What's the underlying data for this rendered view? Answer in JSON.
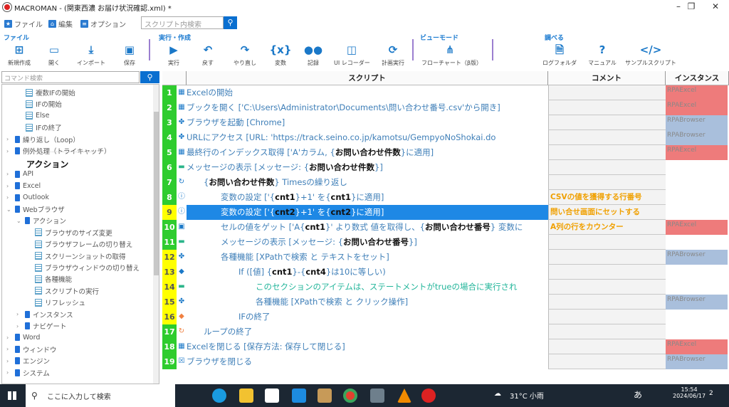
{
  "window": {
    "title": "MACROMAN - (関東西濃 お届け状況確認.xml) *",
    "minimize": "–",
    "maximize": "❐",
    "close": "✕"
  },
  "menu": [
    {
      "label": "ファイル",
      "icon": "star-icon"
    },
    {
      "label": "編集",
      "icon": "home-icon"
    },
    {
      "label": "オプション",
      "icon": "list-icon"
    }
  ],
  "script_search": {
    "placeholder": "スクリプト内検索"
  },
  "toolbar": {
    "groups": {
      "file": "ファイル",
      "run": "実行・作成",
      "view": "ビューモード",
      "lookup": "調べる"
    },
    "buttons": [
      {
        "label": "新規作成",
        "icon": "new-file-icon",
        "glyph": "⊞"
      },
      {
        "label": "開く",
        "icon": "folder-icon",
        "glyph": "▭"
      },
      {
        "label": "インポート",
        "icon": "import-icon",
        "glyph": "⤓"
      },
      {
        "label": "保存",
        "icon": "save-icon",
        "glyph": "▣"
      },
      {
        "label": "実行",
        "icon": "play-icon",
        "glyph": "▶"
      },
      {
        "label": "戻す",
        "icon": "undo-icon",
        "glyph": "↶"
      },
      {
        "label": "やり直し",
        "icon": "redo-icon",
        "glyph": "↷"
      },
      {
        "label": "変数",
        "icon": "variable-icon",
        "glyph": "{x}"
      },
      {
        "label": "記録",
        "icon": "record-icon",
        "glyph": "●●"
      },
      {
        "label": "UI レコーダー",
        "icon": "ui-recorder-icon",
        "glyph": "◫"
      },
      {
        "label": "計画実行",
        "icon": "schedule-icon",
        "glyph": "⟳"
      },
      {
        "label": "フローチャート（β版）",
        "icon": "flowchart-icon",
        "glyph": "⋔"
      },
      {
        "label": "ログフォルダ",
        "icon": "log-folder-icon",
        "glyph": "🗎"
      },
      {
        "label": "マニュアル",
        "icon": "help-icon",
        "glyph": "?"
      },
      {
        "label": "サンプルスクリプト",
        "icon": "sample-script-icon",
        "glyph": "</>"
      }
    ]
  },
  "command_search": {
    "placeholder": "コマンド検索"
  },
  "tree": [
    {
      "label": "複数IFの開始",
      "type": "doc",
      "level": 2
    },
    {
      "label": "IFの開始",
      "type": "doc",
      "level": 2
    },
    {
      "label": "Else",
      "type": "doc",
      "level": 2
    },
    {
      "label": "IFの終了",
      "type": "doc",
      "level": 2
    },
    {
      "label": "繰り返し（Loop）",
      "type": "book",
      "level": 1,
      "chev": "›"
    },
    {
      "label": "例外処理（トライキャッチ）",
      "type": "book",
      "level": 1,
      "chev": "›"
    },
    {
      "label": "アクション",
      "type": "heading",
      "level": 1
    },
    {
      "label": "API",
      "type": "book",
      "level": 1,
      "chev": "›"
    },
    {
      "label": "Excel",
      "type": "book",
      "level": 1,
      "chev": "›"
    },
    {
      "label": "Outlook",
      "type": "book",
      "level": 1,
      "chev": "›"
    },
    {
      "label": "Webブラウザ",
      "type": "book",
      "level": 1,
      "chev": "⌄"
    },
    {
      "label": "アクション",
      "type": "book",
      "level": 2,
      "chev": "⌄"
    },
    {
      "label": "ブラウザのサイズ変更",
      "type": "doc",
      "level": 3
    },
    {
      "label": "ブラウザフレームの切り替え",
      "type": "doc",
      "level": 3
    },
    {
      "label": "スクリーンショットの取得",
      "type": "doc",
      "level": 3
    },
    {
      "label": "ブラウザウィンドウの切り替え",
      "type": "doc",
      "level": 3
    },
    {
      "label": "各種機能",
      "type": "doc",
      "level": 3
    },
    {
      "label": "スクリプトの実行",
      "type": "doc",
      "level": 3
    },
    {
      "label": "リフレッシュ",
      "type": "doc",
      "level": 3
    },
    {
      "label": "インスタンス",
      "type": "book",
      "level": 2,
      "chev": "›"
    },
    {
      "label": "ナビゲート",
      "type": "book",
      "level": 2,
      "chev": "›"
    },
    {
      "label": "Word",
      "type": "book",
      "level": 1,
      "chev": "›"
    },
    {
      "label": "ウィンドウ",
      "type": "book",
      "level": 1,
      "chev": "›"
    },
    {
      "label": "エンジン",
      "type": "book",
      "level": 1,
      "chev": "›"
    },
    {
      "label": "システム",
      "type": "book",
      "level": 1,
      "chev": "›"
    }
  ],
  "grid": {
    "headers": {
      "script": "スクリプト",
      "comment": "コメント",
      "instance": "インスタンス"
    },
    "colors": {
      "green": "#2ecc2e",
      "yellow": "#ffff00",
      "excel": "#ee7b7b",
      "browser": "#a9bfdc",
      "selected": "#1e88e5"
    },
    "rows": [
      {
        "num": "1",
        "mark": "green",
        "icon": "excel-icon",
        "indent": 0,
        "segs": [
          [
            "Excelの開始",
            0
          ]
        ],
        "comment": "",
        "instance": "RPAExcel"
      },
      {
        "num": "2",
        "mark": "green",
        "icon": "excel-icon",
        "indent": 0,
        "segs": [
          [
            "ブックを開く ['C:\\Users\\Administrator\\Documents\\問い合わせ番号.csv'から開き]",
            0
          ]
        ],
        "comment": "",
        "instance": "RPAExcel"
      },
      {
        "num": "3",
        "mark": "green",
        "icon": "browser-icon",
        "indent": 0,
        "segs": [
          [
            "ブラウザを起動 [Chrome]",
            0
          ]
        ],
        "comment": "",
        "instance": "RPABrowser"
      },
      {
        "num": "4",
        "mark": "green",
        "icon": "browser-icon",
        "indent": 0,
        "segs": [
          [
            "URLにアクセス [URL: 'https://track.seino.co.jp/kamotsu/GempyoNoShokai.do",
            0
          ]
        ],
        "comment": "",
        "instance": "RPABrowser"
      },
      {
        "num": "5",
        "mark": "green",
        "icon": "excel-icon",
        "indent": 0,
        "segs": [
          [
            "最終行のインデックス取得 ['A'カラム, {",
            0
          ],
          [
            "お問い合わせ件数",
            1
          ],
          [
            "}に適用]",
            0
          ]
        ],
        "comment": "",
        "instance": "RPAExcel"
      },
      {
        "num": "6",
        "mark": "green",
        "icon": "message-icon",
        "indent": 0,
        "segs": [
          [
            "メッセージの表示 [メッセージ: {",
            0
          ],
          [
            "お問い合わせ件数",
            1
          ],
          [
            "}]",
            0
          ]
        ],
        "comment": "",
        "instance": ""
      },
      {
        "num": "7",
        "mark": "green",
        "icon": "loop-icon",
        "indent": 1,
        "segs": [
          [
            "{",
            0
          ],
          [
            "お問い合わせ件数",
            1
          ],
          [
            "} Timesの繰り返し",
            0
          ]
        ],
        "comment": "",
        "instance": ""
      },
      {
        "num": "8",
        "mark": "green",
        "icon": "variable-set-icon",
        "indent": 2,
        "segs": [
          [
            "変数の設定 ['{",
            0
          ],
          [
            "cnt1",
            1
          ],
          [
            "}+1' を{",
            0
          ],
          [
            "cnt1",
            1
          ],
          [
            "}に適用]",
            0
          ]
        ],
        "comment": "CSVの値を獲得する行番号",
        "instance": ""
      },
      {
        "num": "9",
        "mark": "yellow",
        "icon": "variable-set-icon",
        "indent": 2,
        "selected": true,
        "segs": [
          [
            "変数の設定 ['{",
            0
          ],
          [
            "cnt2",
            1
          ],
          [
            "}+1' を{",
            0
          ],
          [
            "cnt2",
            1
          ],
          [
            "}に適用]",
            0
          ]
        ],
        "comment": "問い合せ画面にセットする",
        "instance": ""
      },
      {
        "num": "10",
        "mark": "green",
        "icon": "cell-icon",
        "indent": 2,
        "segs": [
          [
            "セルの値をゲット ['A{",
            0
          ],
          [
            "cnt1",
            1
          ],
          [
            "}' より数式 値を取得し、{",
            0
          ],
          [
            "お問い合わせ番号",
            1
          ],
          [
            "} 変数に",
            0
          ]
        ],
        "comment": "A列の行をカウンター",
        "instance": "RPAExcel"
      },
      {
        "num": "11",
        "mark": "green",
        "icon": "message-icon",
        "indent": 2,
        "segs": [
          [
            "メッセージの表示 [メッセージ: {",
            0
          ],
          [
            "お問い合わせ番号",
            1
          ],
          [
            "}]",
            0
          ]
        ],
        "comment": "",
        "instance": ""
      },
      {
        "num": "12",
        "mark": "yellow",
        "icon": "browser-icon",
        "indent": 2,
        "segs": [
          [
            "各種機能 [XPathで検索 と テキストをセット]",
            0
          ]
        ],
        "comment": "",
        "instance": "RPABrowser"
      },
      {
        "num": "13",
        "mark": "yellow",
        "icon": "if-icon",
        "indent": 3,
        "segs": [
          [
            "If ([値] {",
            0
          ],
          [
            "cnt1",
            1
          ],
          [
            "}-{",
            0
          ],
          [
            "cnt4",
            1
          ],
          [
            "}は10に等しい)",
            0
          ]
        ],
        "comment": "",
        "instance": ""
      },
      {
        "num": "14",
        "mark": "yellow",
        "icon": "message-icon",
        "indent": 4,
        "note": true,
        "segs": [
          [
            "このセクションのアイテムは、ステートメントがtrueの場合に実行され",
            0
          ]
        ],
        "comment": "",
        "instance": ""
      },
      {
        "num": "15",
        "mark": "yellow",
        "icon": "browser-icon",
        "indent": 4,
        "segs": [
          [
            "各種機能 [XPathで検索 と クリック操作]",
            0
          ]
        ],
        "comment": "",
        "instance": "RPABrowser"
      },
      {
        "num": "16",
        "mark": "yellow",
        "icon": "if-end-icon",
        "indent": 3,
        "segs": [
          [
            "IFの終了",
            0
          ]
        ],
        "comment": "",
        "instance": ""
      },
      {
        "num": "17",
        "mark": "green",
        "icon": "loop-end-icon",
        "indent": 1,
        "segs": [
          [
            "ループの終了",
            0
          ]
        ],
        "comment": "",
        "instance": ""
      },
      {
        "num": "18",
        "mark": "green",
        "icon": "excel-icon",
        "indent": 0,
        "segs": [
          [
            "Excelを閉じる [保存方法: 保存して閉じる]",
            0
          ]
        ],
        "comment": "",
        "instance": "RPAExcel"
      },
      {
        "num": "19",
        "mark": "green",
        "icon": "close-browser-icon",
        "indent": 0,
        "segs": [
          [
            "ブラウザを閉じる",
            0
          ]
        ],
        "comment": "",
        "instance": "RPABrowser"
      }
    ]
  },
  "taskbar": {
    "search_placeholder": "ここに入力して検索",
    "weather": "31°C 小雨",
    "ime": "あ",
    "time": "15:54",
    "date": "2024/06/17",
    "notifications": "2"
  }
}
